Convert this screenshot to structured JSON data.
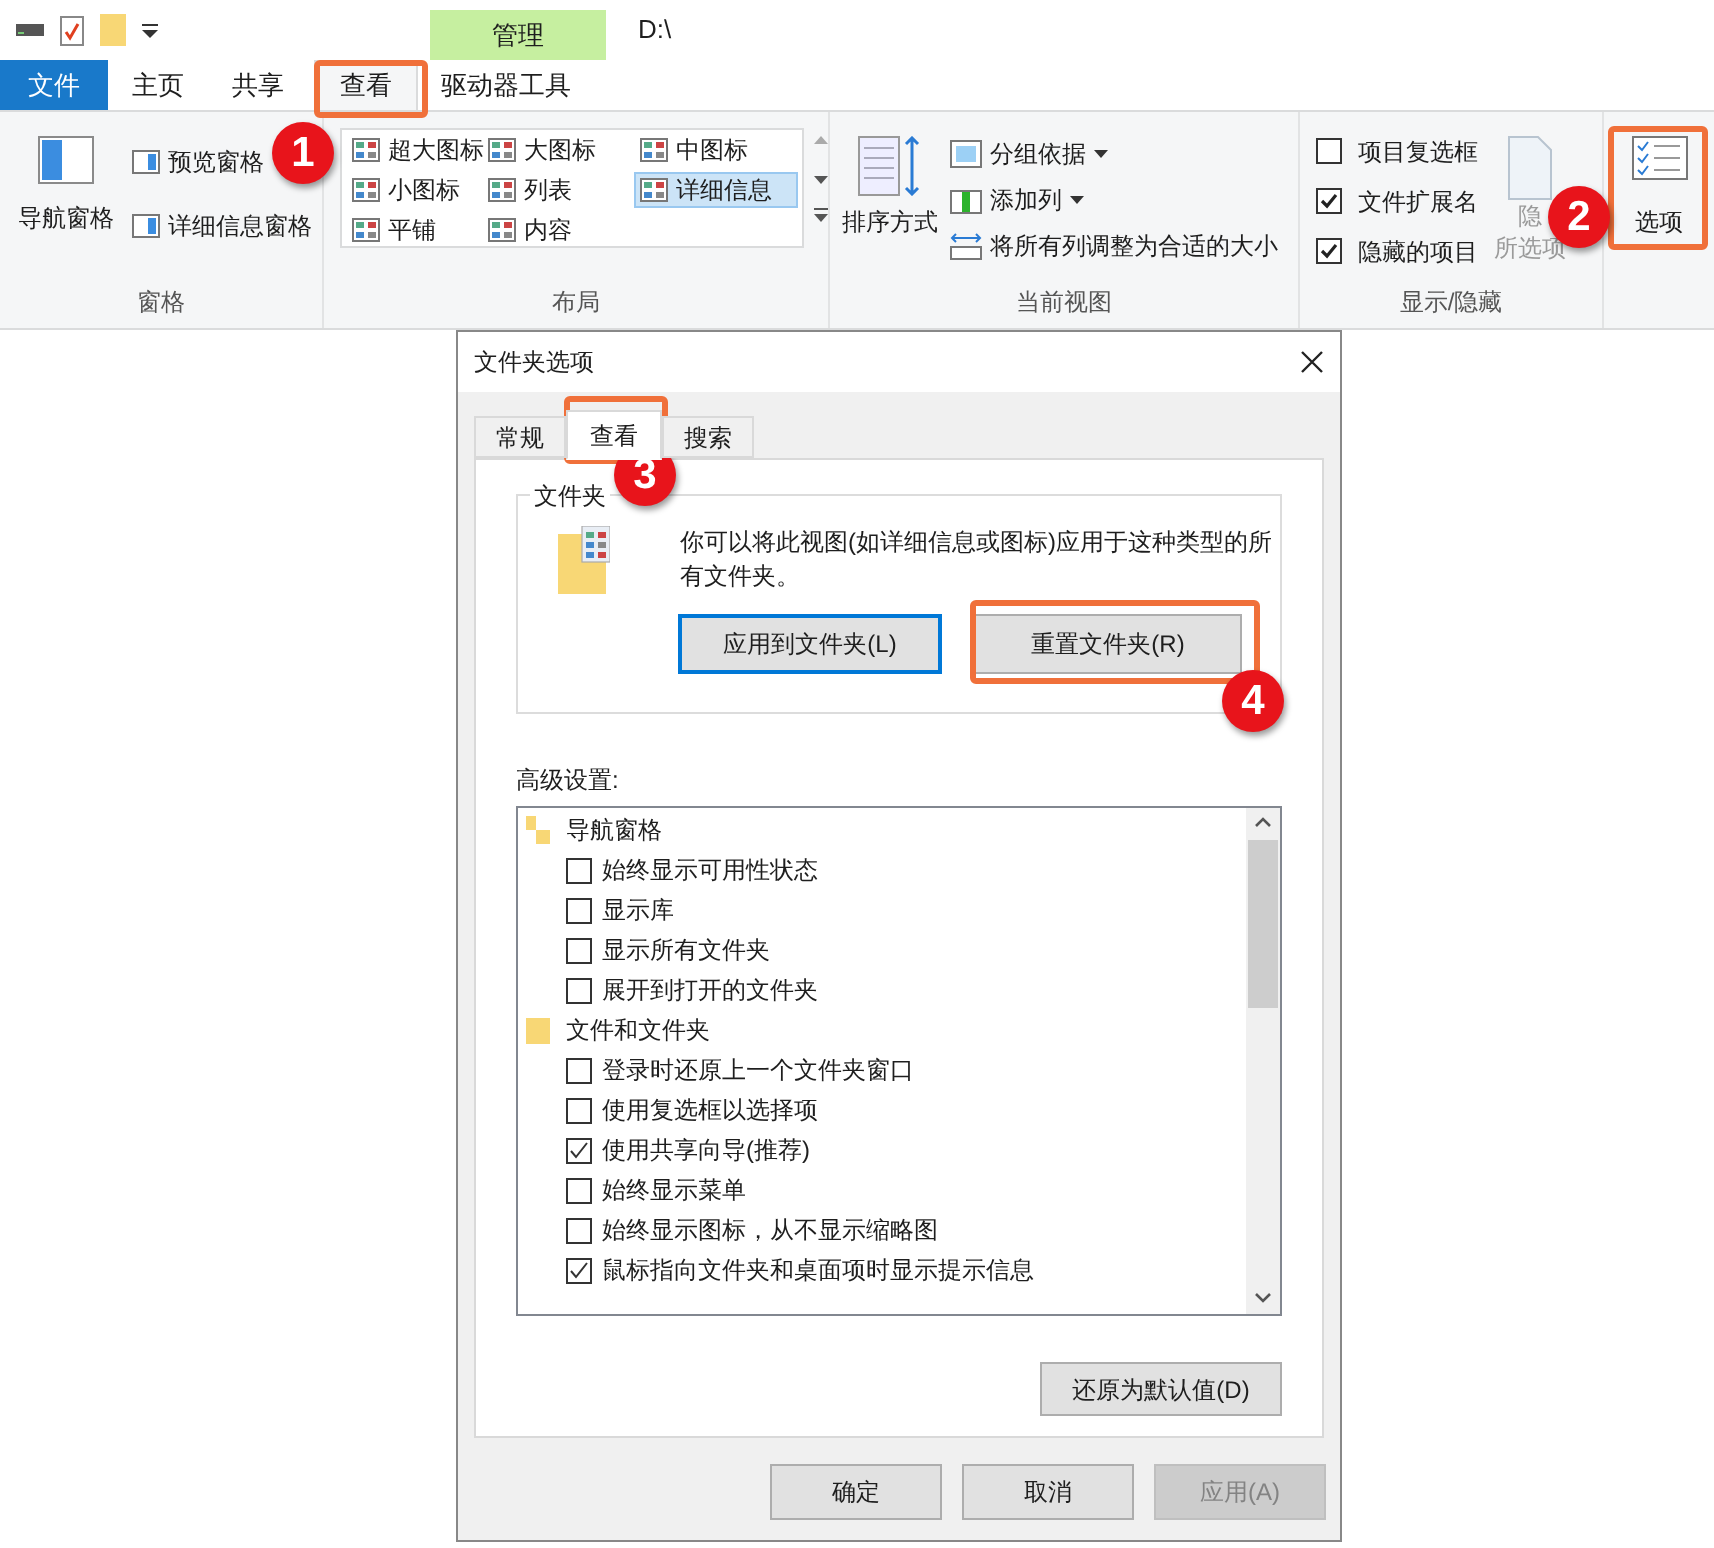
{
  "title_bar": {
    "contextual_tab": "管理",
    "path": "D:\\"
  },
  "ribbon_tabs": [
    {
      "label": "文件",
      "kind": "file",
      "selected": false
    },
    {
      "label": "主页",
      "kind": "tab",
      "selected": false
    },
    {
      "label": "共享",
      "kind": "tab",
      "selected": false
    },
    {
      "label": "查看",
      "kind": "tab",
      "selected": true
    },
    {
      "label": "驱动器工具",
      "kind": "tab",
      "selected": false
    }
  ],
  "panes_group": {
    "label": "窗格",
    "nav_pane": "导航窗格",
    "preview_pane": "预览窗格",
    "details_pane": "详细信息窗格"
  },
  "layout_group": {
    "label": "布局",
    "options": [
      {
        "label": "超大图标",
        "selected": false
      },
      {
        "label": "大图标",
        "selected": false
      },
      {
        "label": "中图标",
        "selected": false
      },
      {
        "label": "小图标",
        "selected": false
      },
      {
        "label": "列表",
        "selected": false
      },
      {
        "label": "详细信息",
        "selected": true
      },
      {
        "label": "平铺",
        "selected": false
      },
      {
        "label": "内容",
        "selected": false
      }
    ]
  },
  "current_view_group": {
    "label": "当前视图",
    "sort_by": "排序方式",
    "group_by": "分组依据",
    "add_columns": "添加列",
    "size_all_columns": "将所有列调整为合适的大小"
  },
  "show_hide_group": {
    "label": "显示/隐藏",
    "checkboxes": [
      {
        "label": "项目复选框",
        "checked": false
      },
      {
        "label": "文件扩展名",
        "checked": true
      },
      {
        "label": "隐藏的项目",
        "checked": true
      }
    ],
    "hide_selected": [
      "隐",
      "所选项"
    ]
  },
  "options_button": "选项",
  "dialog": {
    "title": "文件夹选项",
    "tabs": [
      {
        "label": "常规",
        "selected": false
      },
      {
        "label": "查看",
        "selected": true
      },
      {
        "label": "搜索",
        "selected": false
      }
    ],
    "folder_views": {
      "label": "文件夹",
      "description": "你可以将此视图(如详细信息或图标)应用于这种类型的所有文件夹。",
      "apply_button": "应用到文件夹(L)",
      "reset_button": "重置文件夹(R)"
    },
    "advanced_label": "高级设置:",
    "settings": [
      {
        "label": "导航窗格",
        "kind": "nav",
        "children": [
          {
            "label": "始终显示可用性状态",
            "checked": false
          },
          {
            "label": "显示库",
            "checked": false
          },
          {
            "label": "显示所有文件夹",
            "checked": false
          },
          {
            "label": "展开到打开的文件夹",
            "checked": false
          }
        ]
      },
      {
        "label": "文件和文件夹",
        "kind": "folder",
        "children": [
          {
            "label": "登录时还原上一个文件夹窗口",
            "checked": false
          },
          {
            "label": "使用复选框以选择项",
            "checked": false
          },
          {
            "label": "使用共享向导(推荐)",
            "checked": true
          },
          {
            "label": "始终显示菜单",
            "checked": false
          },
          {
            "label": "始终显示图标，从不显示缩略图",
            "checked": false
          },
          {
            "label": "鼠标指向文件夹和桌面项时显示提示信息",
            "checked": true
          }
        ]
      }
    ],
    "restore_button": "还原为默认值(D)",
    "buttons": [
      {
        "label": "确定",
        "disabled": false
      },
      {
        "label": "取消",
        "disabled": false
      },
      {
        "label": "应用(A)",
        "disabled": true
      }
    ]
  },
  "annotations": [
    {
      "number": "1"
    },
    {
      "number": "2"
    },
    {
      "number": "3"
    },
    {
      "number": "4"
    }
  ]
}
